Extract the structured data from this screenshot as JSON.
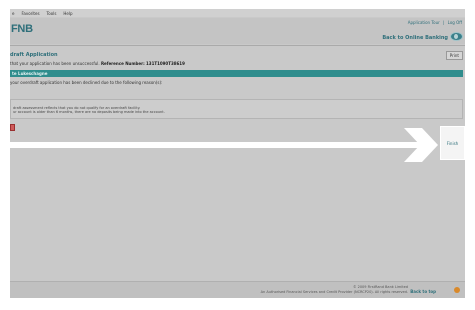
{
  "menubar": {
    "items": [
      "e",
      "Favorites",
      "Tools",
      "Help"
    ]
  },
  "header": {
    "logo_text": "FNB",
    "logo_sub": "",
    "links": [
      "Application Tour",
      "|",
      "Log Off"
    ],
    "back_to_banking": "Back to Online Banking"
  },
  "toolbar": {
    "print_label": "Print"
  },
  "main": {
    "title": "draft Application",
    "notice_prefix": "that your application has been unsuccessful.",
    "reference_label": "Reference Number:",
    "reference_number": "131T1090T38619",
    "section_header": "te Lukeschagne",
    "declined_text": "your overdraft application has been declined due to the following reason(s):",
    "reason_lines": [
      "draft assessment reflects that you do not qualify for an overdraft facility.",
      "ur account is older than 6 months, there are no deposits being made into the account."
    ]
  },
  "actions": {
    "finish_label": "Finish"
  },
  "footer": {
    "copyright_line1": "© 2009 FirstRand Bank Limited",
    "copyright_line2": "An Authorised Financial Services and Credit Provider (NCRCP20). All rights reserved.",
    "back_to_top": "Back to top"
  },
  "colors": {
    "brand_teal": "#2e6f7a",
    "section_bar": "#2f8d8d",
    "window_bg": "#c9c9c9"
  }
}
